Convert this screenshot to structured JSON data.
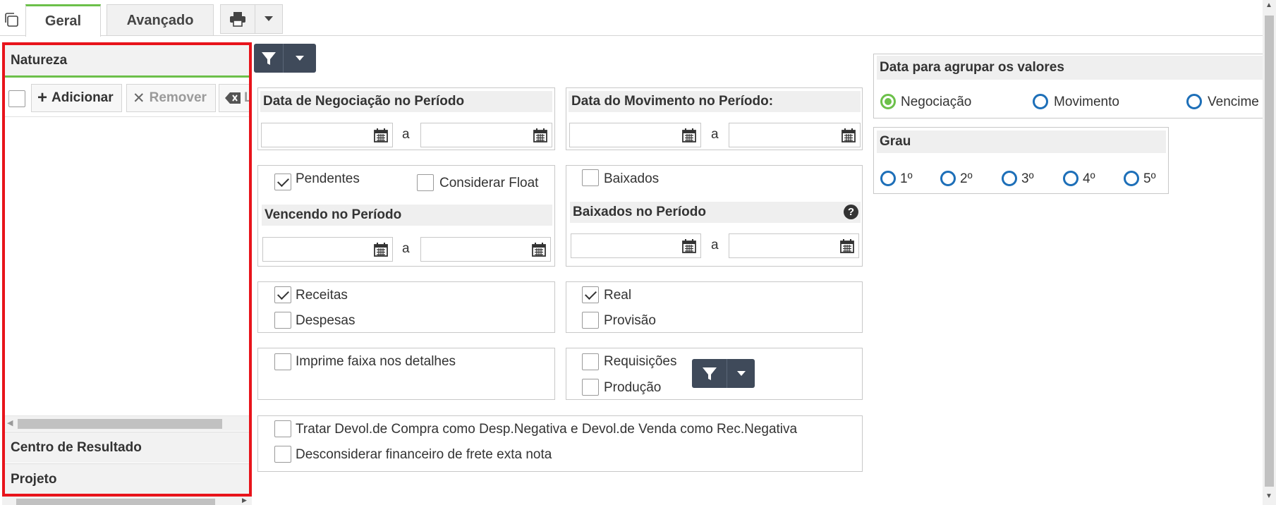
{
  "tabs": [
    {
      "label": "Geral",
      "active": true
    },
    {
      "label": "Avançado",
      "active": false
    }
  ],
  "left_panel": {
    "section_natureza": "Natureza",
    "toolbar": {
      "add_label": "Adicionar",
      "remove_label": "Remover",
      "clear_label": "L"
    },
    "section_centro": "Centro de Resultado",
    "section_projeto": "Projeto"
  },
  "dates": {
    "negociacao_title": "Data de Negociação no Período",
    "movimento_title": "Data do Movimento no Período:",
    "separator": "a",
    "vencendo_title": "Vencendo no Período",
    "baixados_title": "Baixados no Período"
  },
  "checks": {
    "pendentes": {
      "label": "Pendentes",
      "checked": true
    },
    "considerar_float": {
      "label": "Considerar Float",
      "checked": false
    },
    "baixados": {
      "label": "Baixados",
      "checked": false
    },
    "receitas": {
      "label": "Receitas",
      "checked": true
    },
    "despesas": {
      "label": "Despesas",
      "checked": false
    },
    "real": {
      "label": "Real",
      "checked": true
    },
    "provisao": {
      "label": "Provisão",
      "checked": false
    },
    "imprime_faixa": {
      "label": "Imprime faixa nos detalhes",
      "checked": false
    },
    "requisicoes": {
      "label": "Requisições",
      "checked": false
    },
    "producao": {
      "label": "Produção",
      "checked": false
    },
    "tratar_devol": {
      "label": "Tratar Devol.de Compra como Desp.Negativa e Devol.de Venda como Rec.Negativa",
      "checked": false
    },
    "desconsiderar_frete": {
      "label": "Desconsiderar financeiro de frete exta nota",
      "checked": false
    }
  },
  "agrupar": {
    "title": "Data para agrupar os valores",
    "options": [
      "Negociação",
      "Movimento",
      "Vencime"
    ],
    "selected": "Negociação"
  },
  "grau": {
    "title": "Grau",
    "options": [
      "1º",
      "2º",
      "3º",
      "4º",
      "5º"
    ],
    "selected": null
  },
  "icons": {
    "copy": "copy-icon",
    "print": "printer-icon",
    "filter": "filter-icon",
    "calendar": "calendar-icon",
    "help": "question-icon"
  },
  "colors": {
    "accent_green": "#6cc04a",
    "radio_blue": "#1d6fb8",
    "filter_btn": "#3f4a5a",
    "highlight_red": "#e8141b"
  }
}
